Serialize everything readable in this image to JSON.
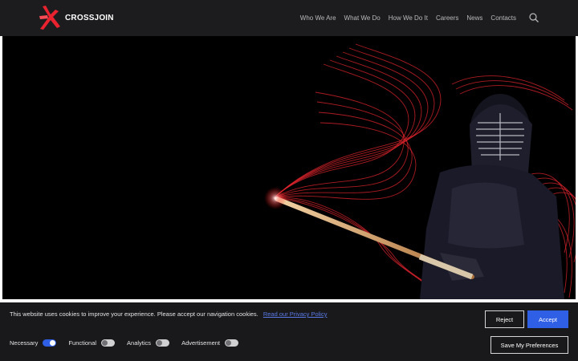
{
  "header": {
    "logo_text": "CROSSJOIN",
    "nav": [
      "Who We Are",
      "What We Do",
      "How We Do It",
      "Careers",
      "News",
      "Contacts"
    ]
  },
  "cookie_banner": {
    "message": "This website uses cookies to improve your experience. Please accept our navigation cookies.",
    "privacy_link": "Read our Privacy Policy",
    "reject_label": "Reject",
    "accept_label": "Accept",
    "preferences_label": "Save My Preferences",
    "toggles": [
      {
        "label": "Necessary",
        "on": true
      },
      {
        "label": "Functional",
        "on": false
      },
      {
        "label": "Analytics",
        "on": false
      },
      {
        "label": "Advertisement",
        "on": false
      }
    ]
  },
  "colors": {
    "header_bg": "#1c1c1e",
    "accent": "#2f5fe5",
    "brand_red": "#e8232f",
    "link": "#5a7ae8"
  }
}
